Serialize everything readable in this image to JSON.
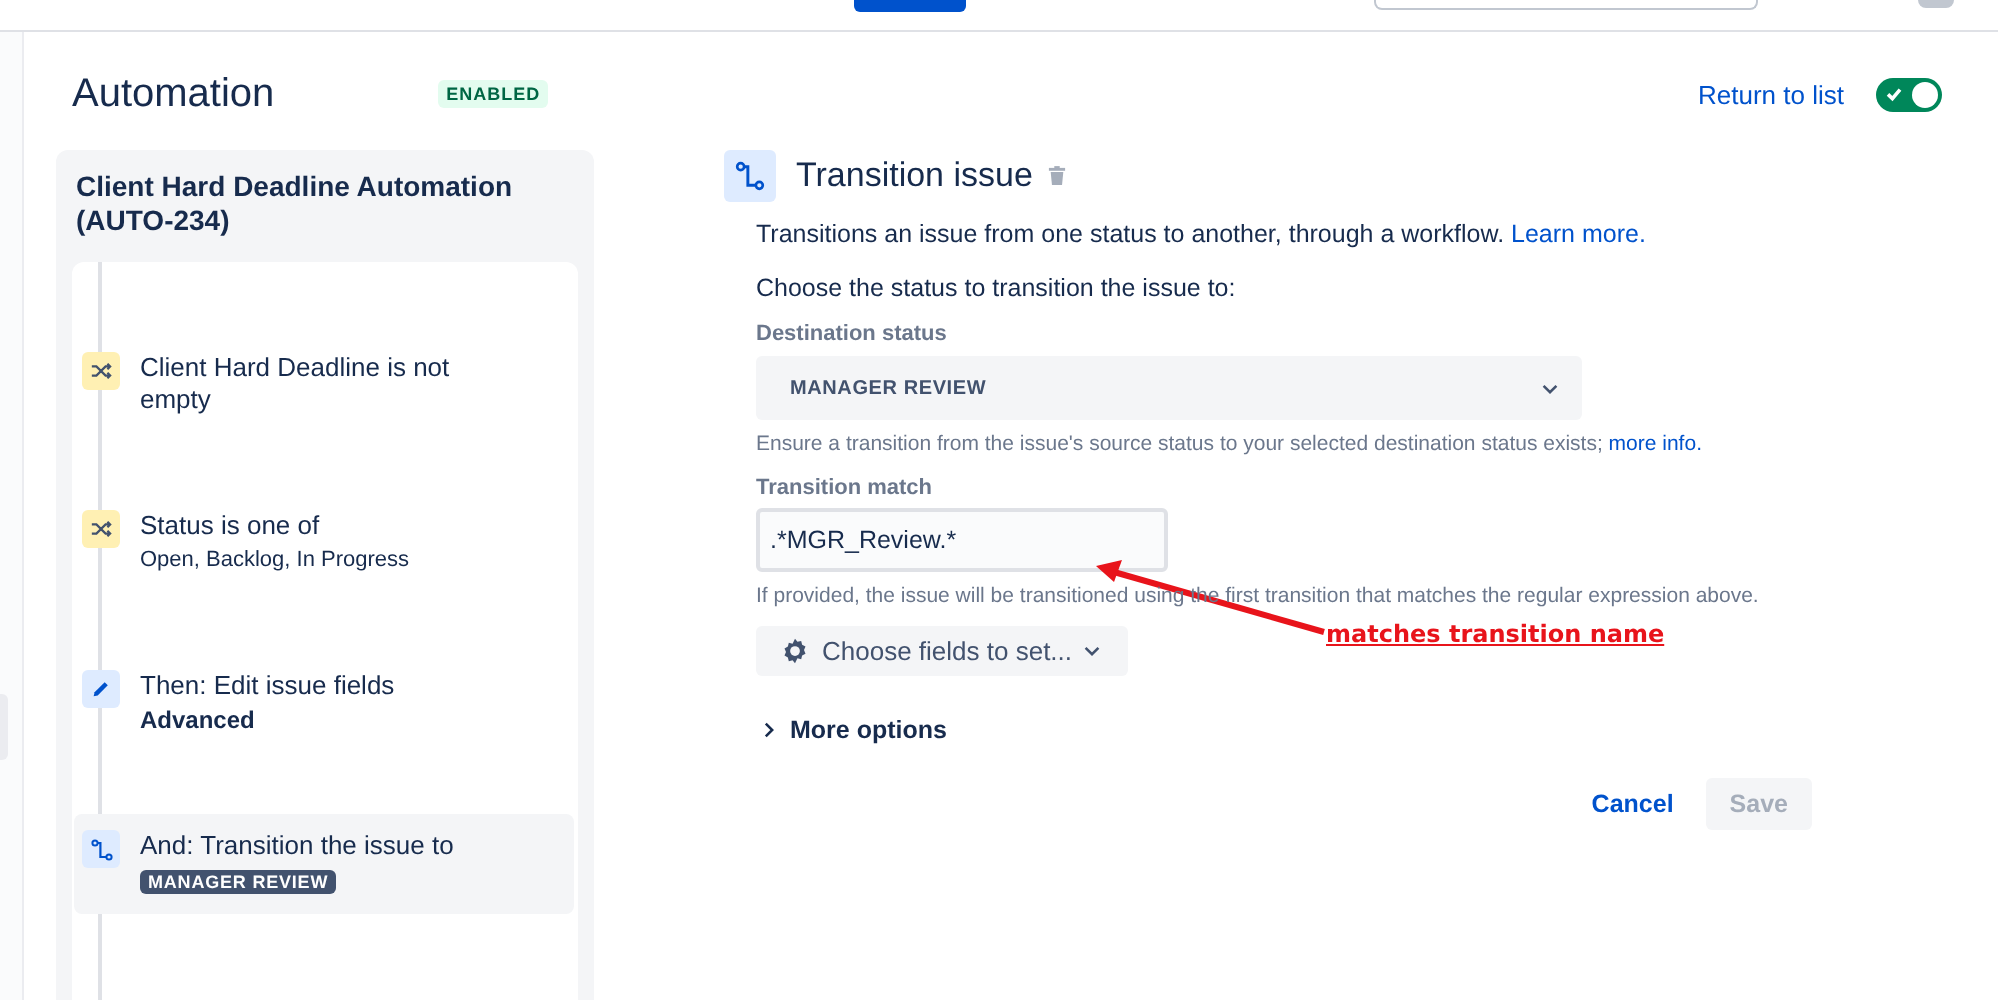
{
  "header": {
    "title": "Automation",
    "status_badge": "ENABLED",
    "return_link": "Return to list",
    "rule_toggle": {
      "on": true
    }
  },
  "rule": {
    "title": "Client Hard Deadline Automation (AUTO-234)",
    "steps": [
      {
        "kind": "condition",
        "title": "Client Hard Deadline is not empty",
        "selected": false
      },
      {
        "kind": "condition",
        "title": "Status is one of",
        "detail": "Open, Backlog, In Progress",
        "detail_bold": false,
        "selected": false
      },
      {
        "kind": "edit",
        "title": "Then: Edit issue fields",
        "detail": "Advanced",
        "detail_bold": true,
        "selected": false
      },
      {
        "kind": "transition",
        "title": "And: Transition the issue to",
        "lozenge": "MANAGER REVIEW",
        "selected": true
      }
    ]
  },
  "editor": {
    "title": "Transition issue",
    "description": "Transitions an issue from one status to another, through a workflow.",
    "learn_more": "Learn more.",
    "prompt": "Choose the status to transition the issue to:",
    "destination": {
      "label": "Destination status",
      "value": "MANAGER REVIEW",
      "help": "Ensure a transition from the issue's source status to your selected destination status exists;",
      "help_link": "more info."
    },
    "match": {
      "label": "Transition match",
      "value": ".*MGR_Review.*",
      "help": "If provided, the issue will be transitioned using the first transition that matches the regular expression above."
    },
    "fields_button": "Choose fields to set...",
    "more_options": {
      "label": "More options",
      "expanded": false
    },
    "cancel": "Cancel",
    "save": {
      "label": "Save",
      "disabled": true
    }
  },
  "annotation": {
    "text": "matches transition name"
  }
}
